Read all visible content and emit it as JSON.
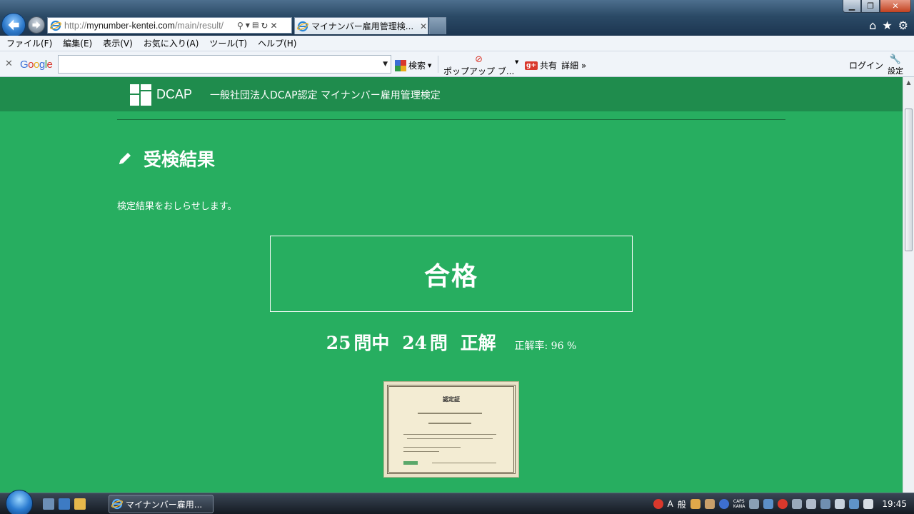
{
  "browser": {
    "address_url_prefix": "http://",
    "address_host": "mynumber-kentei.com",
    "address_path": "/main/result/",
    "tab_title": "マイナンバー雇用管理検...",
    "menu": [
      "ファイル(F)",
      "編集(E)",
      "表示(V)",
      "お気に入り(A)",
      "ツール(T)",
      "ヘルプ(H)"
    ],
    "google": {
      "logo": "Google",
      "search_label": "検索",
      "popup_label": "ポップアップ ブ...",
      "share_label": "共有",
      "more_label": "詳細 »",
      "login_label": "ログイン",
      "settings_label": "設定"
    }
  },
  "site": {
    "logo_text": "DCAP",
    "title": "一般社団法人DCAP認定 マイナンバー雇用管理検定"
  },
  "page": {
    "heading": "受検結果",
    "intro": "検定結果をおしらせします。",
    "result": "合格",
    "score": {
      "total": "25",
      "total_unit": "問中",
      "correct": "24",
      "correct_unit": "問",
      "correct_label": "正解",
      "rate_label": "正解率: 96 %"
    },
    "certificate_title": "認定証"
  },
  "taskbar": {
    "task_label": "マイナンバー雇用...",
    "ime_a": "A",
    "ime_mode": "般",
    "caps": "CAPS",
    "kana": "KANA",
    "clock": "19:45"
  },
  "colors": {
    "page_bg": "#27ae60",
    "header_bg": "#1f8c4d"
  }
}
